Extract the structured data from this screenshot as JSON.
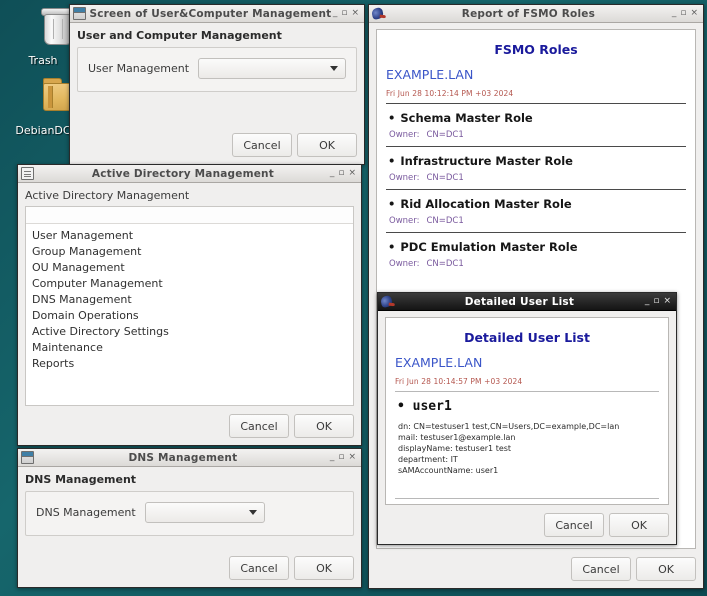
{
  "desktop": {
    "icons": [
      {
        "label": "Trash",
        "icon": "trash-icon"
      },
      {
        "label": "DebianDC",
        "icon": "folder-icon"
      }
    ]
  },
  "windows": {
    "user_computer": {
      "title": "Screen of User&Computer Management",
      "icon": "window-icon",
      "group_title": "User and Computer Management",
      "field_label": "User Management",
      "combo_value": "",
      "cancel": "Cancel",
      "ok": "OK",
      "minimize": "_",
      "maximize": "▫",
      "close": "×"
    },
    "ad_management": {
      "title": "Active Directory Management",
      "icon": "list-icon",
      "label": "Active Directory Management",
      "items": [
        "User Management",
        "Group Management",
        "OU Management",
        "Computer Management",
        "DNS Management",
        "Domain Operations",
        "Active Directory Settings",
        "Maintenance",
        "Reports"
      ],
      "cancel": "Cancel",
      "ok": "OK",
      "minimize": "_",
      "maximize": "▫",
      "close": "×"
    },
    "dns_management": {
      "title": "DNS Management",
      "icon": "window-icon",
      "group_title": "DNS Management",
      "field_label": "DNS Management",
      "combo_value": "",
      "cancel": "Cancel",
      "ok": "OK",
      "minimize": "_",
      "maximize": "▫",
      "close": "×"
    },
    "fsmo_report": {
      "title": "Report of FSMO Roles",
      "icon": "bird-icon",
      "report_heading": "FSMO Roles",
      "domain": "EXAMPLE.LAN",
      "date": "Fri Jun 28 10:12:14 PM +03 2024",
      "owner_label": "Owner:",
      "roles": [
        {
          "name": "Schema Master Role",
          "owner": "CN=DC1"
        },
        {
          "name": "Infrastructure Master Role",
          "owner": "CN=DC1"
        },
        {
          "name": "Rid Allocation Master Role",
          "owner": "CN=DC1"
        },
        {
          "name": "PDC Emulation Master Role",
          "owner": "CN=DC1"
        }
      ],
      "cancel": "Cancel",
      "ok": "OK",
      "minimize": "_",
      "maximize": "▫",
      "close": "×"
    },
    "detailed_user_list": {
      "title": "Detailed User List",
      "icon": "bird-icon",
      "report_heading": "Detailed User List",
      "domain": "EXAMPLE.LAN",
      "date": "Fri Jun 28 10:14:57 PM +03 2024",
      "user": "user1",
      "attributes": [
        "dn: CN=testuser1 test,CN=Users,DC=example,DC=lan",
        "mail: testuser1@example.lan",
        "displayName: testuser1 test",
        "department: IT",
        "sAMAccountName: user1"
      ],
      "cancel": "Cancel",
      "ok": "OK",
      "minimize": "_",
      "maximize": "▫",
      "close": "×"
    }
  },
  "colors": {
    "desktop_bg": "#14585f",
    "report_heading": "#1a1a9c",
    "report_domain": "#3a55c8",
    "report_date": "#b4564e",
    "report_owner": "#7a5a9e"
  }
}
